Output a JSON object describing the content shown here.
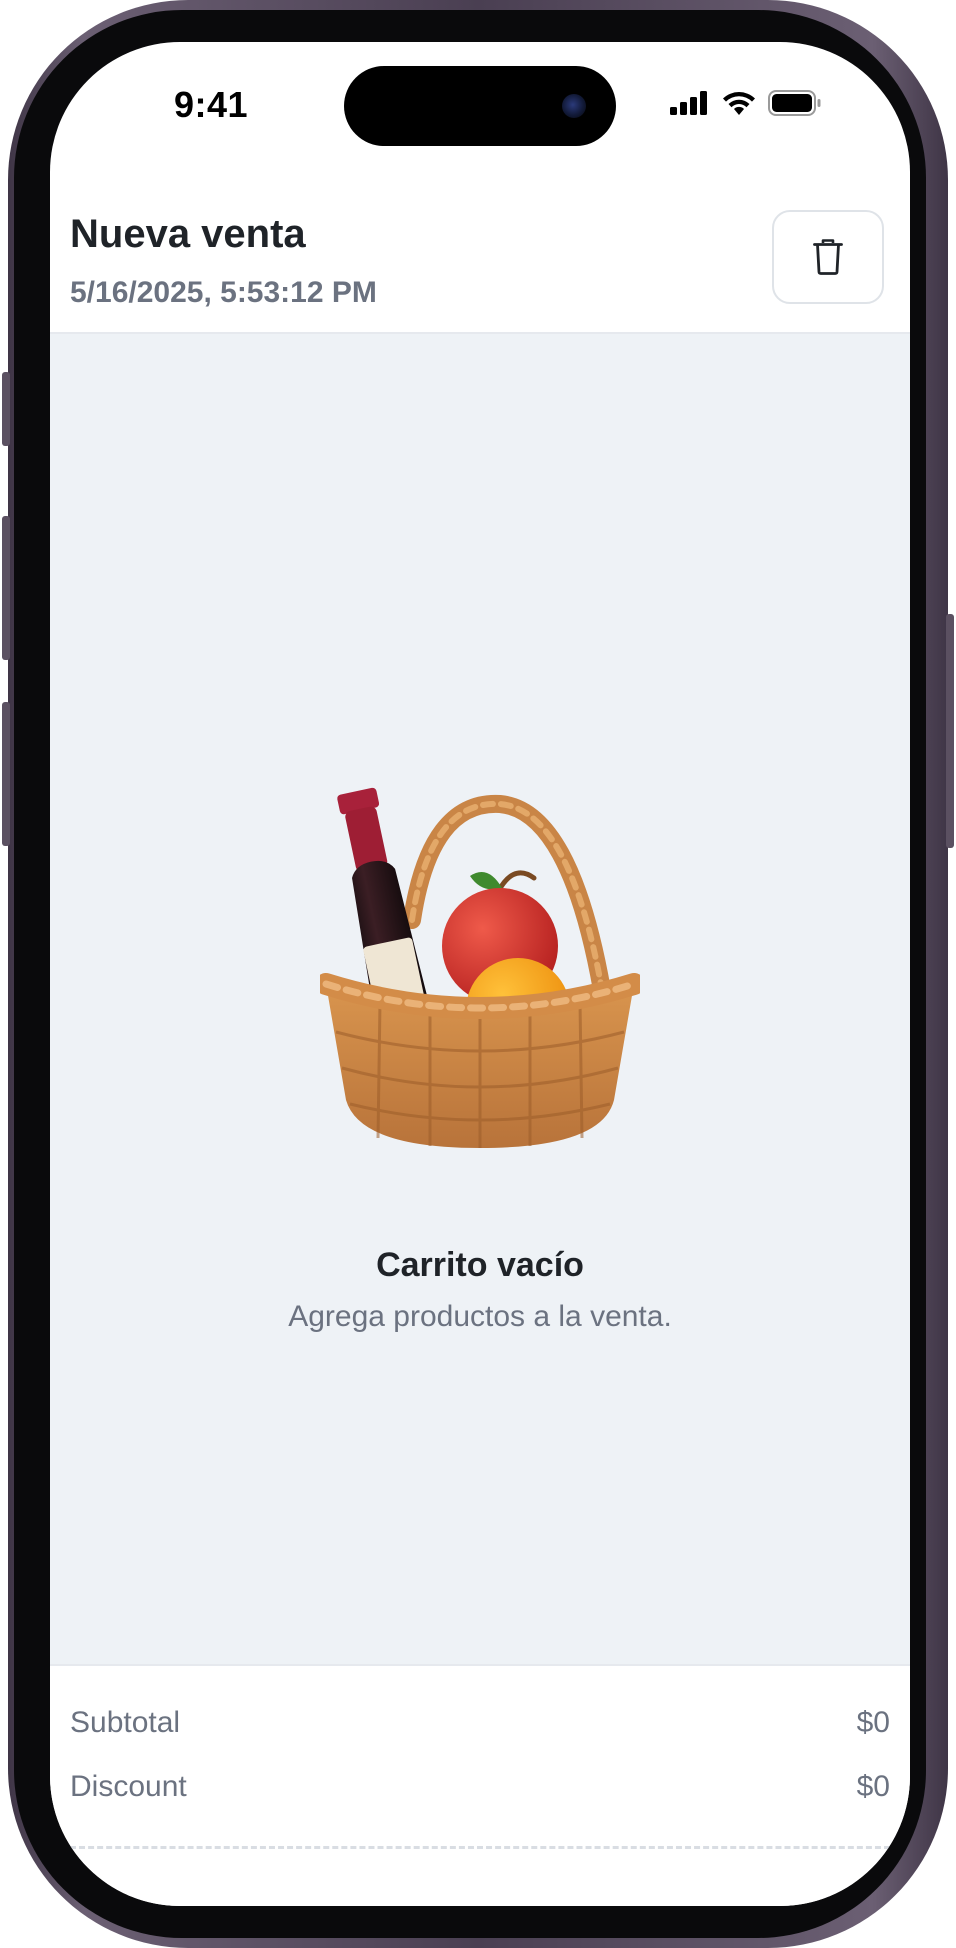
{
  "status_bar": {
    "time": "9:41",
    "icons": [
      "cellular-signal-icon",
      "wifi-icon",
      "battery-icon"
    ]
  },
  "header": {
    "title": "Nueva venta",
    "datetime": "5/16/2025, 5:53:12 PM",
    "actions": [
      "trash-icon"
    ]
  },
  "empty_state": {
    "illustration": "basket-with-wine-and-fruit",
    "title": "Carrito vacío",
    "subtitle": "Agrega productos a la venta."
  },
  "summary": {
    "subtotal_label": "Subtotal",
    "subtotal_value": "$0",
    "discount_label": "Discount",
    "discount_value": "$0"
  },
  "colors": {
    "content_background": "#eef2f6",
    "title_text": "#1f2328",
    "muted_text": "#6b7280",
    "divider": "#e6e9ee"
  }
}
